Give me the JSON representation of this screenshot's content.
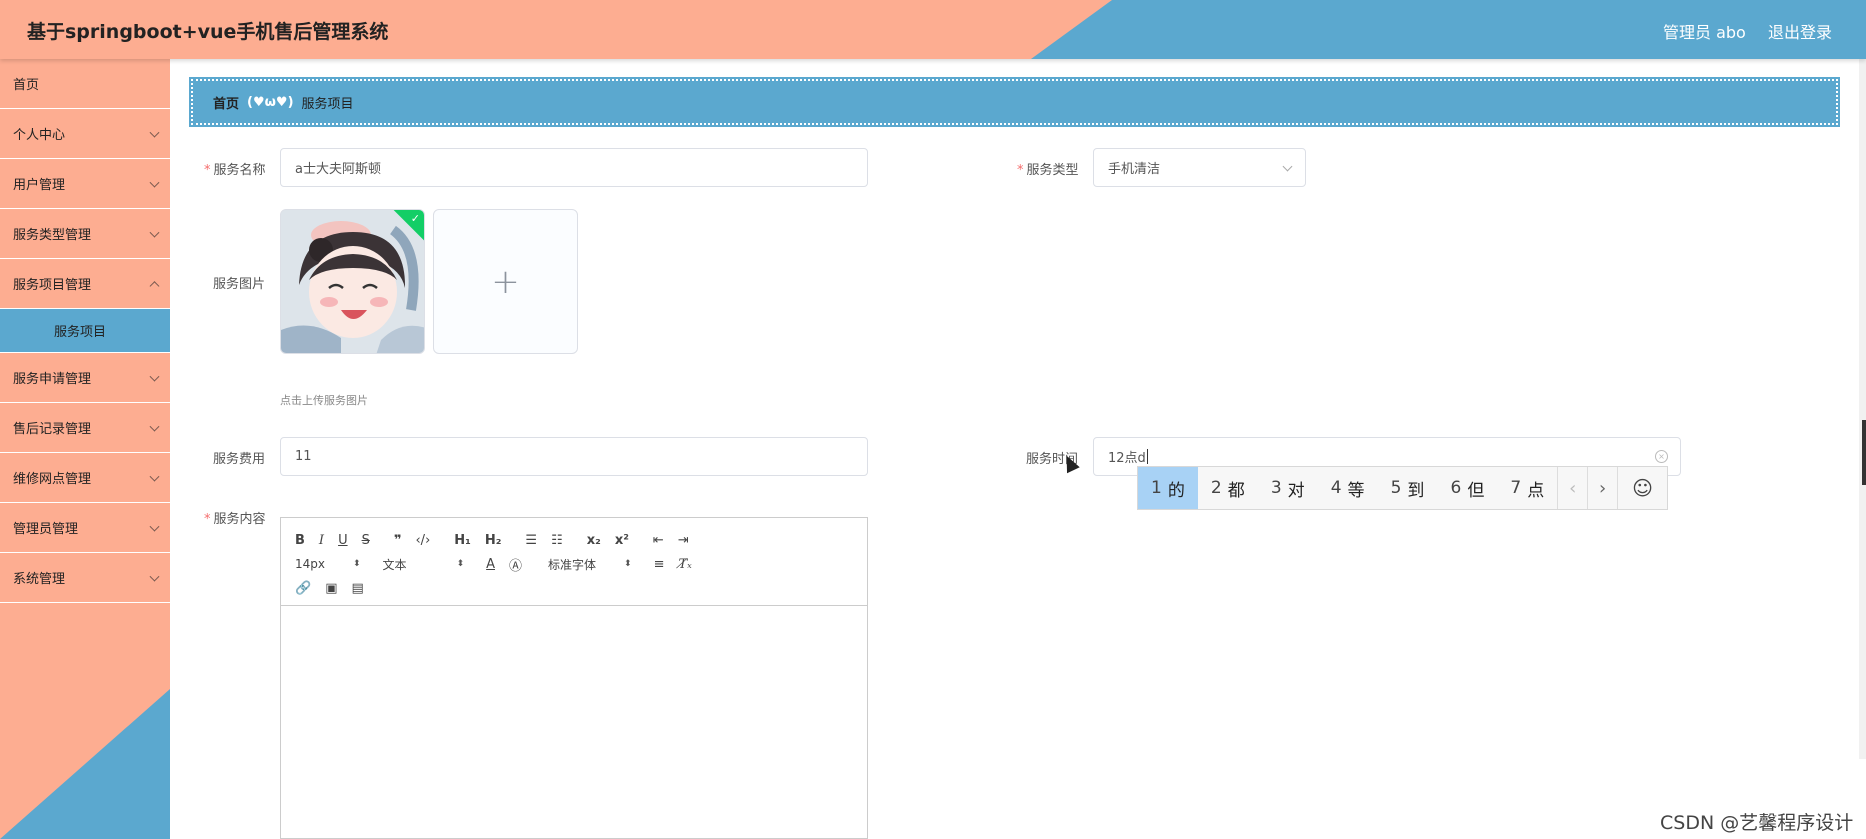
{
  "header": {
    "title": "基于springboot+vue手机售后管理系统",
    "admin": "管理员 abo",
    "logout": "退出登录"
  },
  "sidebar": {
    "items": [
      {
        "label": "首页"
      },
      {
        "label": "个人中心"
      },
      {
        "label": "用户管理"
      },
      {
        "label": "服务类型管理"
      },
      {
        "label": "服务项目管理"
      },
      {
        "label": "服务项目"
      },
      {
        "label": "服务申请管理"
      },
      {
        "label": "售后记录管理"
      },
      {
        "label": "维修网点管理"
      },
      {
        "label": "管理员管理"
      },
      {
        "label": "系统管理"
      }
    ]
  },
  "breadcrumb": {
    "home": "首页",
    "separator": "(♥ω♥)",
    "current": "服务项目"
  },
  "form": {
    "name_label": "服务名称",
    "name_value": "a士大夫阿斯顿",
    "type_label": "服务类型",
    "type_value": "手机清洁",
    "image_label": "服务图片",
    "image_tip": "点击上传服务图片",
    "fee_label": "服务费用",
    "fee_value": "11",
    "time_label": "服务时间",
    "time_value": "12点d",
    "content_label": "服务内容"
  },
  "ime": {
    "candidates": [
      {
        "n": "1",
        "c": "的"
      },
      {
        "n": "2",
        "c": "都"
      },
      {
        "n": "3",
        "c": "对"
      },
      {
        "n": "4",
        "c": "等"
      },
      {
        "n": "5",
        "c": "到"
      },
      {
        "n": "6",
        "c": "但"
      },
      {
        "n": "7",
        "c": "点"
      }
    ]
  },
  "editor": {
    "size": "14px",
    "header": "文本",
    "font": "标准字体"
  },
  "watermark": "CSDN @艺馨程序设计"
}
